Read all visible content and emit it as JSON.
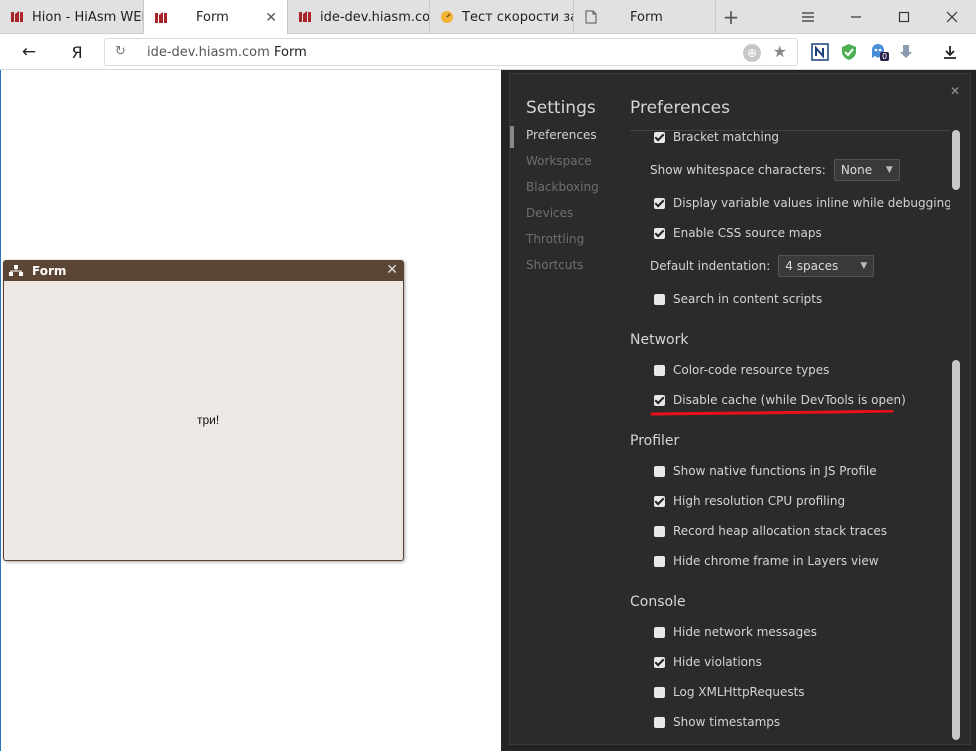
{
  "tabs": [
    {
      "label": "Hion - HiAsm WEB",
      "icon": "hiasm-icon",
      "active": false
    },
    {
      "label": "Form",
      "icon": "hiasm-icon",
      "active": true
    },
    {
      "label": "ide-dev.hiasm.com",
      "icon": "hiasm-icon",
      "active": false
    },
    {
      "label": "Тест скорости загр",
      "icon": "speedtest-icon",
      "active": false
    },
    {
      "label": "Form",
      "icon": "page-icon",
      "active": false
    }
  ],
  "address": {
    "back_glyph": "←",
    "yandex_glyph": "Я",
    "host": "ide-dev.hiasm.com",
    "title": "Form"
  },
  "form": {
    "title": "Form",
    "label": "три!"
  },
  "devtools": {
    "settings_title": "Settings",
    "sidebar": [
      "Preferences",
      "Workspace",
      "Blackboxing",
      "Devices",
      "Throttling",
      "Shortcuts"
    ],
    "pref_title": "Preferences",
    "items": {
      "bracket": {
        "label": "Bracket matching",
        "checked": true
      },
      "whitespace": {
        "label": "Show whitespace characters:",
        "value": "None"
      },
      "inline_values": {
        "label": "Display variable values inline while debugging",
        "checked": true
      },
      "css_maps": {
        "label": "Enable CSS source maps",
        "checked": true
      },
      "indentation": {
        "label": "Default indentation:",
        "value": "4 spaces"
      },
      "content_scripts": {
        "label": "Search in content scripts",
        "checked": false
      },
      "color_code": {
        "label": "Color-code resource types",
        "checked": false
      },
      "disable_cache": {
        "label": "Disable cache (while DevTools is open)",
        "checked": true
      },
      "native_fns": {
        "label": "Show native functions in JS Profile",
        "checked": false
      },
      "high_res": {
        "label": "High resolution CPU profiling",
        "checked": true
      },
      "heap_traces": {
        "label": "Record heap allocation stack traces",
        "checked": false
      },
      "chrome_frame": {
        "label": "Hide chrome frame in Layers view",
        "checked": false
      },
      "net_msgs": {
        "label": "Hide network messages",
        "checked": false
      },
      "violations": {
        "label": "Hide violations",
        "checked": true
      },
      "xhr": {
        "label": "Log XMLHttpRequests",
        "checked": false
      },
      "timestamps": {
        "label": "Show timestamps",
        "checked": false
      }
    },
    "sections": {
      "network": "Network",
      "profiler": "Profiler",
      "console": "Console"
    },
    "ext_badge": "0",
    "highlight_color": "#e8101a"
  }
}
